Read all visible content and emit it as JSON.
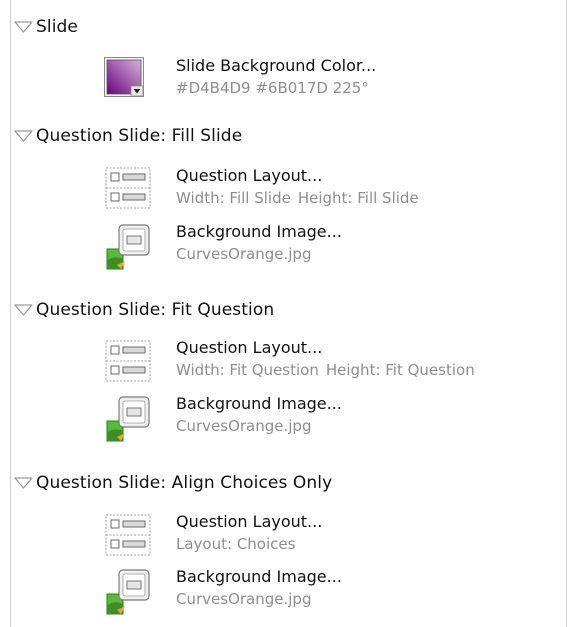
{
  "sections": [
    {
      "title": "Slide",
      "items": [
        {
          "icon": "color-swatch-icon",
          "label": "Slide Background Color...",
          "value": "#D4B4D9 #6B017D 225°",
          "colors": [
            "#D4B4D9",
            "#6B017D"
          ]
        }
      ]
    },
    {
      "title": "Question Slide: Fill Slide",
      "items": [
        {
          "icon": "question-layout-icon",
          "label": "Question Layout...",
          "value_parts": [
            "Width: Fill Slide",
            "Height: Fill Slide"
          ]
        },
        {
          "icon": "background-image-icon",
          "label": "Background Image...",
          "value": "CurvesOrange.jpg"
        }
      ]
    },
    {
      "title": "Question Slide: Fit Question",
      "items": [
        {
          "icon": "question-layout-icon",
          "label": "Question Layout...",
          "value_parts": [
            "Width: Fit Question",
            "Height: Fit Question"
          ]
        },
        {
          "icon": "background-image-icon",
          "label": "Background Image...",
          "value": "CurvesOrange.jpg"
        }
      ]
    },
    {
      "title": "Question Slide: Align Choices Only",
      "items": [
        {
          "icon": "question-layout-icon",
          "label": "Question Layout...",
          "value": "Layout: Choices"
        },
        {
          "icon": "background-image-icon",
          "label": "Background Image...",
          "value": "CurvesOrange.jpg"
        }
      ]
    }
  ]
}
